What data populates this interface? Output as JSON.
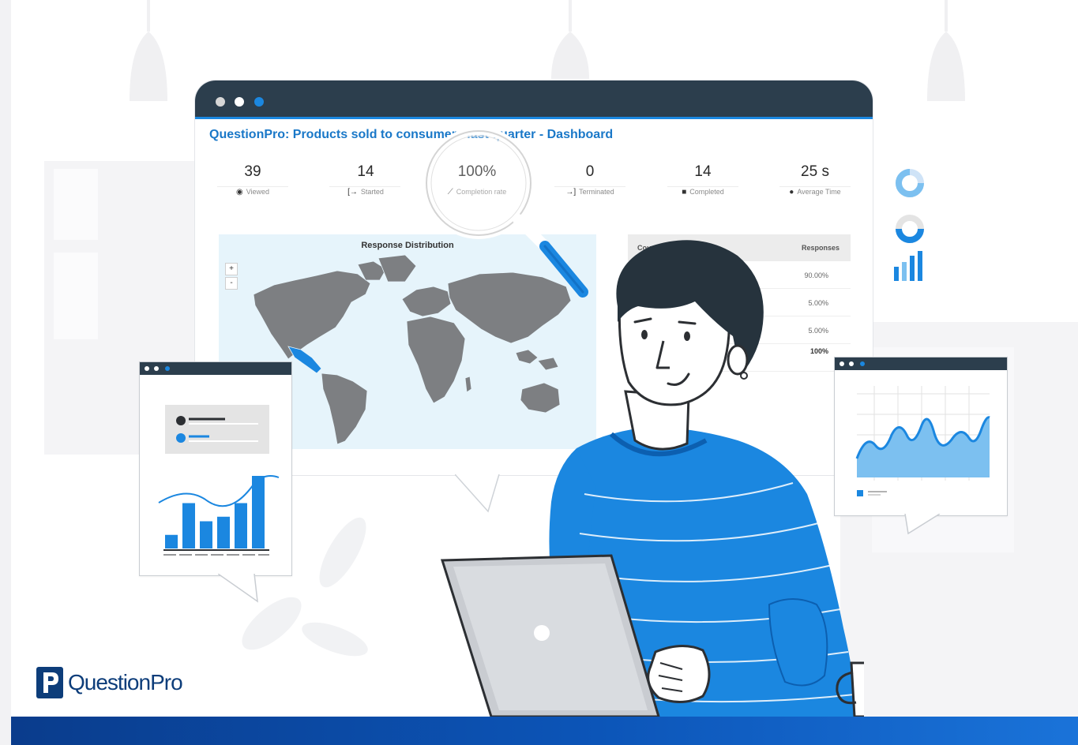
{
  "brand": {
    "name": "QuestionPro",
    "colors": {
      "navy": "#0d3d7a",
      "blue": "#1a78c8",
      "bright_blue": "#1b87e0",
      "dark_bar": "#2c3e4d"
    }
  },
  "dashboard": {
    "title": "QuestionPro: Products sold to consumers last quarter - Dashboard",
    "metrics": [
      {
        "value": "39",
        "label": "Viewed",
        "icon": "eye-icon"
      },
      {
        "value": "14",
        "label": "Started",
        "icon": "enter-icon"
      },
      {
        "value": "100%",
        "label": "Completion rate",
        "icon": "trend-chart-icon"
      },
      {
        "value": "0",
        "label": "Terminated",
        "icon": "exit-icon"
      },
      {
        "value": "14",
        "label": "Completed",
        "icon": "checkbox-icon"
      },
      {
        "value": "25 s",
        "label": "Average Time",
        "icon": "clock-icon"
      }
    ],
    "map": {
      "title": "Response Distribution",
      "zoom_in": "+",
      "zoom_out": "-"
    },
    "table": {
      "headers": [
        "Country",
        "Responses"
      ],
      "rows": [
        "90.00%",
        "5.00%",
        "5.00%",
        "100%"
      ]
    }
  },
  "illustration": {
    "left_window_bar_values": [
      3,
      10,
      6,
      7,
      10,
      16
    ],
    "right_window_area_trend": "wavy-upward",
    "side_icons": [
      "ring-chart-icon",
      "ring-chart-icon",
      "bar-chart-icon"
    ]
  }
}
